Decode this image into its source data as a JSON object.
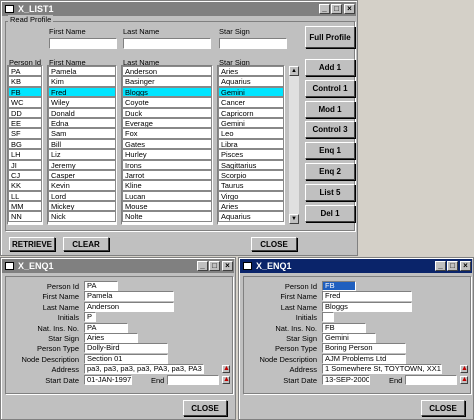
{
  "main": {
    "title": "X_LIST1",
    "group_title": "Read Profile",
    "search_labels": {
      "first_name": "First Name",
      "last_name": "Last Name",
      "star_sign": "Star Sign"
    },
    "full_profile": "Full Profile",
    "columns": {
      "person_id": "Person Id",
      "first_name": "First Name",
      "last_name": "Last Name",
      "star_sign": "Star Sign"
    },
    "person_ids": [
      "PA",
      "KB",
      "FB",
      "WC",
      "DD",
      "EE",
      "SF",
      "BG",
      "LH",
      "JI",
      "CJ",
      "KK",
      "LL",
      "MM",
      "NN"
    ],
    "first_names": [
      "Pamela",
      "Kim",
      "Fred",
      "Wiley",
      "Donald",
      "Edna",
      "Sam",
      "Bill",
      "Liz",
      "Jeremy",
      "Casper",
      "Kevin",
      "Lord",
      "Mickey",
      "Nick"
    ],
    "last_names": [
      "Anderson",
      "Basinger",
      "Bloggs",
      "Coyote",
      "Duck",
      "Everage",
      "Fox",
      "Gates",
      "Hurley",
      "Irons",
      "Jarrot",
      "Kline",
      "Lucan",
      "Mouse",
      "Nolte"
    ],
    "star_signs": [
      "Aries",
      "Aquarius",
      "Gemini",
      "Cancer",
      "Capricorn",
      "Gemini",
      "Leo",
      "Libra",
      "Pisces",
      "Sagittarius",
      "Scorpio",
      "Taurus",
      "Virgo",
      "Aries",
      "Aquarius"
    ],
    "side_buttons": [
      "Add 1",
      "Control 1",
      "Mod 1",
      "Control 3",
      "Enq 1",
      "Enq 2",
      "List 5",
      "Del 1"
    ],
    "retrieve": "RETRIEVE",
    "clear": "CLEAR",
    "close": "CLOSE"
  },
  "enq_left": {
    "title": "X_ENQ1",
    "labels": [
      "Person Id",
      "First Name",
      "Last Name",
      "Initials",
      "Nat. Ins. No.",
      "Star Sign",
      "Person Type",
      "Node Description",
      "Address",
      "Start Date"
    ],
    "end_label": "End",
    "values": {
      "person_id": "PA",
      "first_name": "Pamela",
      "last_name": "Anderson",
      "initials": "P",
      "nat_ins": "PA",
      "star_sign": "Aries",
      "person_type": "Dolly-Bird",
      "node_description": "Section 01",
      "address": "pa3, pa3, pa3, pa3, PA3, pa3, PA3",
      "start_date": "01-JAN-1997",
      "end_date": ""
    },
    "close": "CLOSE"
  },
  "enq_right": {
    "title": "X_ENQ1",
    "labels": [
      "Person Id",
      "First Name",
      "Last Name",
      "Initials",
      "Nat. Ins. No.",
      "Star Sign",
      "Person Type",
      "Node Description",
      "Address",
      "Start Date"
    ],
    "end_label": "End",
    "values": {
      "person_id": "FB",
      "first_name": "Fred",
      "last_name": "Bloggs",
      "initials": "",
      "nat_ins": "FB",
      "star_sign": "Gemini",
      "person_type": "Boring Person",
      "node_description": "AJM Problems Ltd",
      "address": "1 Somewhere St, TOYTOWN, XX1 2YY",
      "start_date": "13-SEP-2000",
      "end_date": ""
    },
    "close": "CLOSE"
  }
}
